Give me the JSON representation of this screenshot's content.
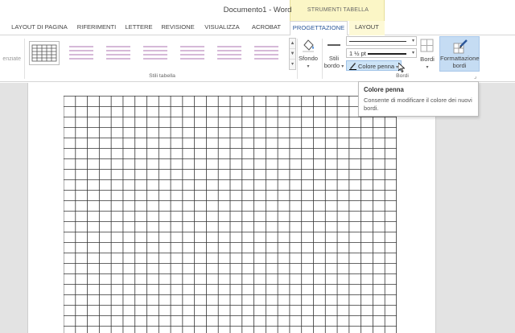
{
  "window": {
    "title": "Documento1 - Word",
    "context_band": "STRUMENTI TABELLA"
  },
  "tabs": [
    {
      "label": "LAYOUT DI PAGINA"
    },
    {
      "label": "RIFERIMENTI"
    },
    {
      "label": "LETTERE"
    },
    {
      "label": "REVISIONE"
    },
    {
      "label": "VISUALIZZA"
    },
    {
      "label": "ACROBAT"
    },
    {
      "label": "PROGETTAZIONE",
      "active": true
    },
    {
      "label": "LAYOUT"
    }
  ],
  "ribbon": {
    "cut_label": "enziate",
    "styles_group_label": "Stili tabella",
    "borders_group_label": "Bordi",
    "sfondo_label": "Sfondo",
    "stili_label": "Stili",
    "bordo_label": "bordo",
    "pen_weight": "1 ½ pt",
    "pen_color_label": "Colore penna",
    "bordi_label": "Bordi",
    "format_label_line1": "Formattazione",
    "format_label_line2": "bordi"
  },
  "tooltip": {
    "title": "Colore penna",
    "description": "Consente di modificare il colore dei nuovi bordi."
  },
  "table": {
    "columns": 28,
    "rows": 23
  },
  "colors": {
    "accent": "#2b579a",
    "context_band": "#fbf6c6",
    "selected_button": "#c5dcf3",
    "thumb_purple": "#c9a2cb"
  },
  "icons": {
    "table_style_thumbnail": "table-style-icon",
    "shading": "paint-bucket-icon",
    "border_styles": "border-styles-icon",
    "pen_color": "pen-icon",
    "borders": "borders-icon",
    "border_painter": "border-painter-icon",
    "dialog_launcher": "dialog-launcher-icon",
    "mouse_cursor": "cursor-icon"
  }
}
